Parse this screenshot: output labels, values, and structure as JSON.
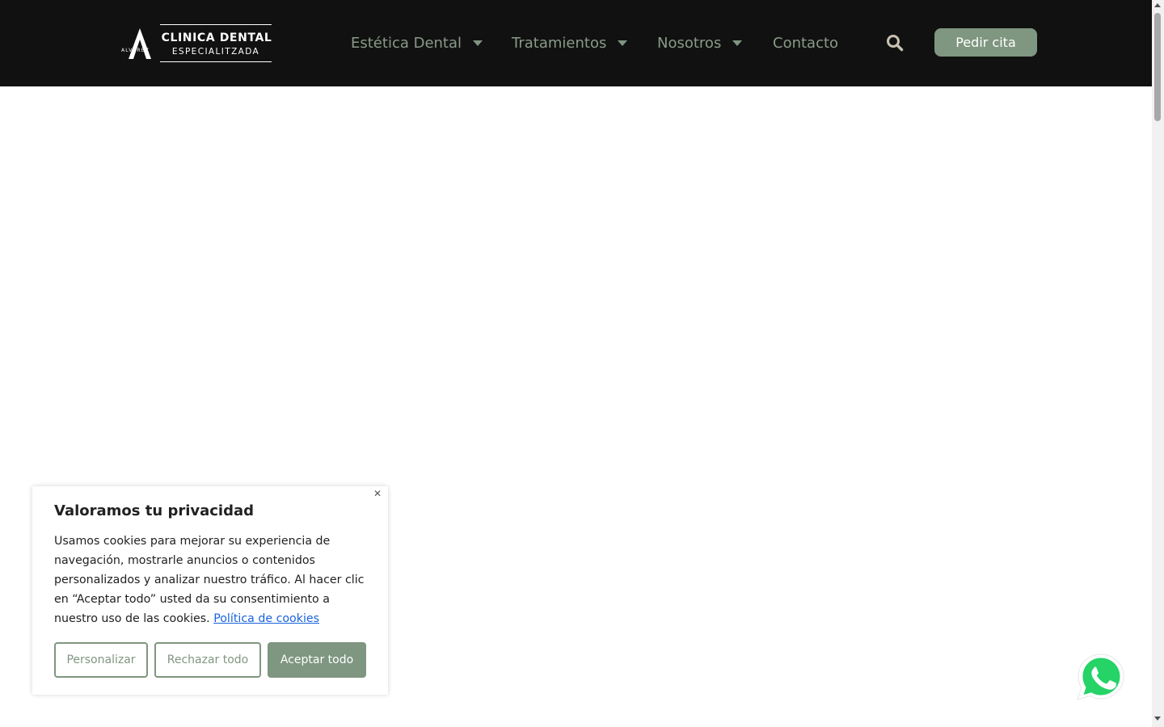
{
  "brand": {
    "name": "CLINICA DENTAL",
    "subtitle": "ESPECIALITZADA",
    "vertical_text": "ALVAREZ"
  },
  "nav": {
    "items": [
      {
        "label": "Estética Dental",
        "has_dropdown": true
      },
      {
        "label": "Tratamientos",
        "has_dropdown": true
      },
      {
        "label": "Nosotros",
        "has_dropdown": true
      },
      {
        "label": "Contacto",
        "has_dropdown": false
      }
    ],
    "search_icon": "search-icon",
    "cta_label": "Pedir cita"
  },
  "cookie_banner": {
    "title": "Valoramos tu privacidad",
    "body": "Usamos cookies para mejorar su experiencia de navegación, mostrarle anuncios o contenidos personalizados y analizar nuestro tráfico. Al hacer clic en “Aceptar todo” usted da su consentimiento a nuestro uso de las cookies.",
    "policy_link": "Política de cookies",
    "buttons": {
      "customize": "Personalizar",
      "reject": "Rechazar todo",
      "accept": "Aceptar todo"
    },
    "close_icon": "close-icon"
  },
  "floating": {
    "whatsapp_icon": "whatsapp-icon"
  },
  "colors": {
    "header_bg": "#111111",
    "accent": "#7f9680",
    "nav_text": "#8a9a88",
    "link": "#1863dc",
    "whatsapp": "#25d366"
  }
}
